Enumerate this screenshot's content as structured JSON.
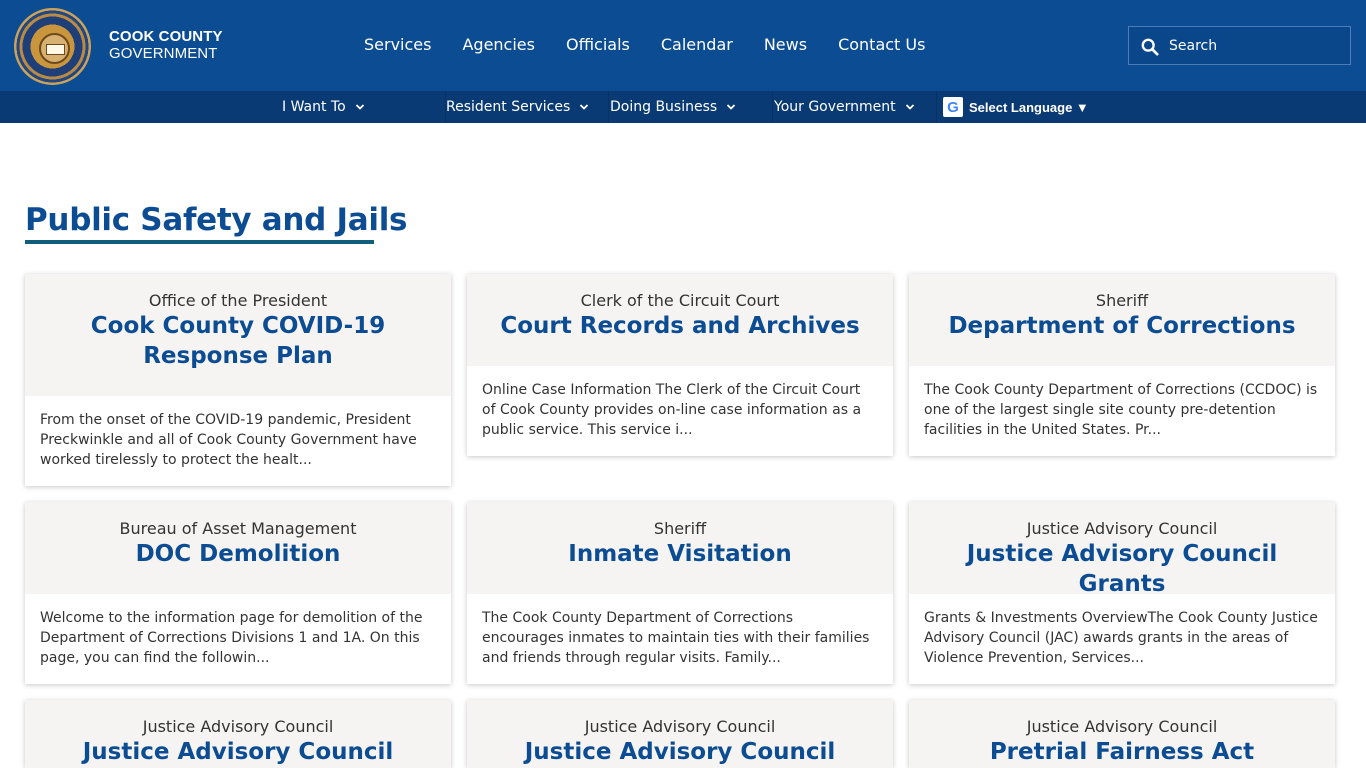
{
  "header": {
    "logo_line1": "COOK COUNTY",
    "logo_line2": "GOVERNMENT",
    "seal_icon": "cook-county-seal",
    "nav": [
      "Services",
      "Agencies",
      "Officials",
      "Calendar",
      "News",
      "Contact Us"
    ],
    "search_placeholder": "Search",
    "search_icon": "search-icon"
  },
  "subnav": {
    "items": [
      "I Want To",
      "Resident Services",
      "Doing Business",
      "Your Government"
    ],
    "language_label": "Select Language ▼"
  },
  "main": {
    "page_title": "Public Safety and Jails",
    "cards": [
      {
        "agency": "Office of the President",
        "title": "Cook County COVID-19 Response Plan",
        "excerpt": "From the onset of the COVID-19 pandemic, President Preckwinkle and all of Cook County Government have worked tirelessly to protect the healt..."
      },
      {
        "agency": "Clerk of the Circuit Court",
        "title": "Court Records and Archives",
        "excerpt": "Online Case Information The Clerk of the Circuit Court of Cook County provides on-line case information as a public service. This service i..."
      },
      {
        "agency": "Sheriff",
        "title": "Department of Corrections",
        "excerpt": "The Cook County Department of Corrections (CCDOC) is one of the largest single site county pre-detention facilities in the United States. Pr..."
      },
      {
        "agency": "Bureau of Asset Management",
        "title": "DOC Demolition",
        "excerpt": "Welcome to the information page for demolition of the Department of Corrections Divisions 1 and 1A. On this page, you can find the followin..."
      },
      {
        "agency": "Sheriff",
        "title": "Inmate Visitation",
        "excerpt": "The Cook County Department of Corrections encourages inmates to maintain ties with their families and friends through regular visits. Family..."
      },
      {
        "agency": "Justice Advisory Council",
        "title": "Justice Advisory Council Grants",
        "excerpt": "Grants & Investments OverviewThe Cook County Justice Advisory Council (JAC) awards grants in the areas of Violence Prevention, Services..."
      },
      {
        "agency": "Justice Advisory Council",
        "title": "Justice Advisory Council",
        "excerpt": ""
      },
      {
        "agency": "Justice Advisory Council",
        "title": "Justice Advisory Council Reentry",
        "excerpt": ""
      },
      {
        "agency": "Justice Advisory Council",
        "title": "Pretrial Fairness Act Resources",
        "excerpt": ""
      }
    ]
  },
  "colors": {
    "header_bg": "#0c4c93",
    "subnav_bg": "#0a3a73",
    "title_blue": "#0c4c93",
    "underline": "#0f5f7c",
    "card_head_bg": "#f5f4f2"
  }
}
